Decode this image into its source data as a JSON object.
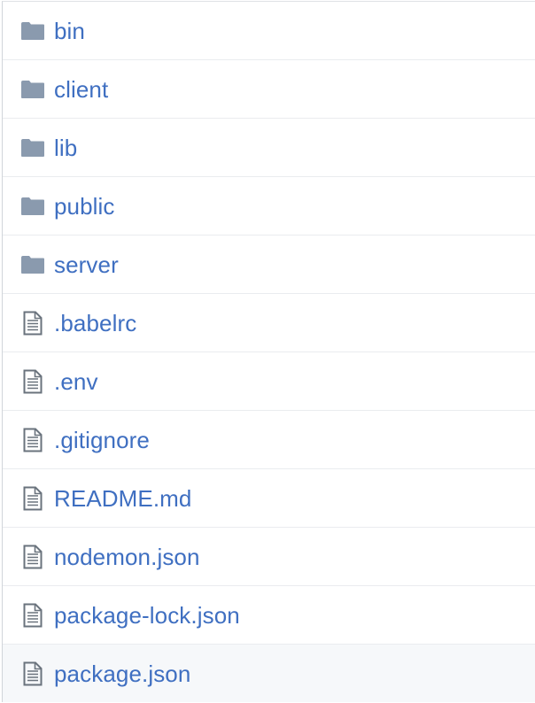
{
  "file_browser": {
    "entries": [
      {
        "type": "folder",
        "icon": "folder-icon",
        "name": "bin"
      },
      {
        "type": "folder",
        "icon": "folder-icon",
        "name": "client"
      },
      {
        "type": "folder",
        "icon": "folder-icon",
        "name": "lib"
      },
      {
        "type": "folder",
        "icon": "folder-icon",
        "name": "public"
      },
      {
        "type": "folder",
        "icon": "folder-icon",
        "name": "server"
      },
      {
        "type": "file",
        "icon": "file-icon",
        "name": ".babelrc"
      },
      {
        "type": "file",
        "icon": "file-icon",
        "name": ".env"
      },
      {
        "type": "file",
        "icon": "file-icon",
        "name": ".gitignore"
      },
      {
        "type": "file",
        "icon": "file-icon",
        "name": "README.md"
      },
      {
        "type": "file",
        "icon": "file-icon",
        "name": "nodemon.json"
      },
      {
        "type": "file",
        "icon": "file-icon",
        "name": "package-lock.json"
      },
      {
        "type": "file",
        "icon": "file-icon",
        "name": "package.json"
      }
    ],
    "highlighted_entry": "package.json",
    "colors": {
      "link": "#3f6fc1",
      "folder_icon": "#8a9aae",
      "file_icon": "#6a737d",
      "row_divider": "#eaecef",
      "hover_background": "#f6f8fa"
    }
  }
}
